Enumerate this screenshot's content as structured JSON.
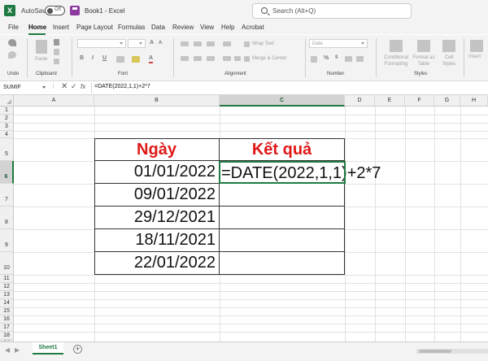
{
  "titlebar": {
    "autosave_label": "AutoSave",
    "toggle_state": "Off",
    "book_title": "Book1  -  Excel",
    "search_placeholder": "Search (Alt+Q)"
  },
  "tabs": [
    "File",
    "Home",
    "Insert",
    "Page Layout",
    "Formulas",
    "Data",
    "Review",
    "View",
    "Help",
    "Acrobat"
  ],
  "active_tab": "Home",
  "ribbon": {
    "undo_label": "Undo",
    "clipboard_label": "Clipboard",
    "paste_label": "Paste",
    "font_label": "Font",
    "alignment_label": "Alignment",
    "wrap_text": "Wrap Text",
    "merge_center": "Merge & Center",
    "number_label": "Number",
    "number_format": "Date",
    "styles_label": "Styles",
    "conditional_formatting": "Conditional Formatting",
    "format_as_table": "Format as Table",
    "cell_styles": "Cell Styles",
    "insert_label": "Insert"
  },
  "formula_bar": {
    "name_box": "SUMIF",
    "cancel_icon": "x-icon",
    "enter_icon": "check-icon",
    "fx": "fx",
    "formula": "=DATE(2022,1,1)+2*7"
  },
  "columns": [
    "A",
    "B",
    "C",
    "D",
    "E",
    "F",
    "G",
    "H"
  ],
  "selected_column": "C",
  "rows": [
    "1",
    "2",
    "3",
    "4",
    "5",
    "6",
    "7",
    "8",
    "9",
    "10",
    "11",
    "12",
    "13",
    "14",
    "15",
    "16",
    "17",
    "18",
    "19"
  ],
  "selected_row": "6",
  "table": {
    "header_date": "Ngày",
    "header_result": "Kết quả",
    "dates": [
      "01/01/2022",
      "09/01/2022",
      "29/12/2021",
      "18/11/2021",
      "22/01/2022"
    ],
    "active_cell_text": "=DATE(2022,1,1)+2*7"
  },
  "sheets": [
    "Sheet1"
  ],
  "colors": {
    "accent": "#1f7a43",
    "header_text": "#e01717"
  }
}
